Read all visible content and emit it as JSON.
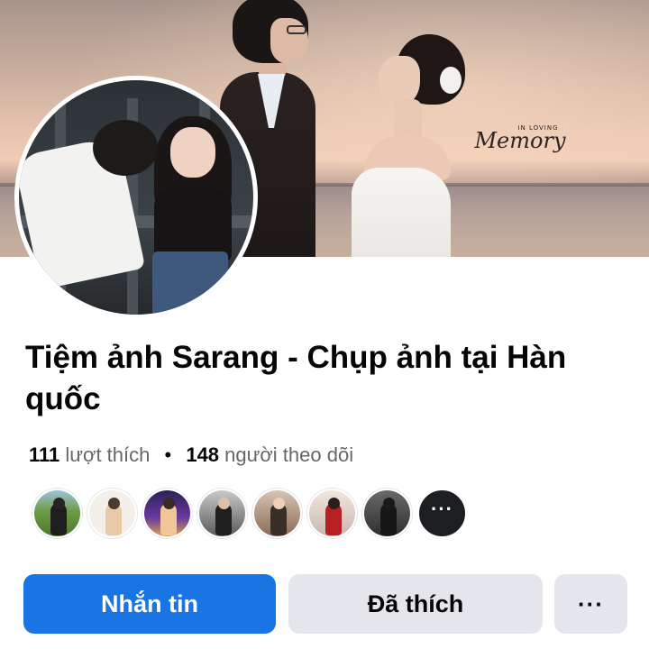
{
  "cover": {
    "watermark_top": "IN LOVING",
    "watermark_main": "Memory"
  },
  "page": {
    "name": "Tiệm ảnh Sarang - Chụp ảnh tại Hàn quốc",
    "likes_count": "111",
    "likes_label": "lượt thích",
    "separator": "•",
    "followers_count": "148",
    "followers_label": "người theo dõi"
  },
  "followers_preview": {
    "more_label": "···",
    "avatar_colors": [
      "#5f8f3a",
      "#f4efe9",
      "#3b2f6e",
      "#2d2d2d",
      "#8b6a55",
      "#8a1f1f",
      "#3a3a3a"
    ]
  },
  "actions": {
    "message_label": "Nhắn tin",
    "liked_label": "Đã thích",
    "more_label": "···"
  },
  "colors": {
    "primary": "#1b74e4",
    "secondary_button": "#e4e6eb",
    "text_primary": "#050505",
    "text_secondary": "#65676b"
  }
}
